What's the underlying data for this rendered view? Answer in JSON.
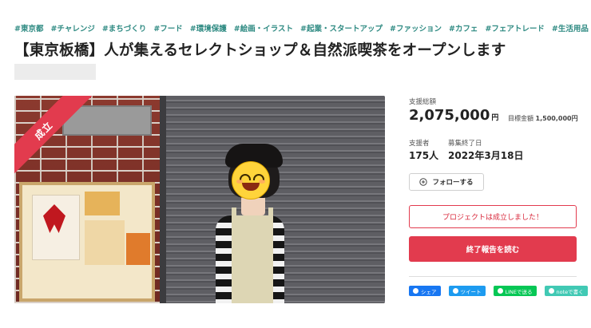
{
  "tags": [
    "#東京都",
    "#チャレンジ",
    "#まちづくり",
    "#フード",
    "#環境保護",
    "#絵画・イラスト",
    "#起業・スタートアップ",
    "#ファッション",
    "#カフェ",
    "#フェアトレード",
    "#生活用品"
  ],
  "project": {
    "title": "【東京板橋】人が集えるセレクトショップ＆自然派喫茶をオープンします",
    "status_badge": "成立"
  },
  "stats": {
    "total_label": "支援総額",
    "total_amount": "2,075,000",
    "currency": "円",
    "goal_label": "目標金額",
    "goal_amount": "1,500,000円",
    "supporters_label": "支援者",
    "supporters_value": "175人",
    "end_label": "募集終了日",
    "end_value": "2022年3月18日"
  },
  "buttons": {
    "follow": "フォローする",
    "success_notice": "プロジェクトは成立しました！",
    "report": "終了報告を読む"
  },
  "share": [
    {
      "label": "シェア",
      "color": "#1877f2",
      "icon": "facebook-icon"
    },
    {
      "label": "ツイート",
      "color": "#1d9bf0",
      "icon": "twitter-icon"
    },
    {
      "label": "LINEで送る",
      "color": "#06c755",
      "icon": "line-icon"
    },
    {
      "label": "noteで書く",
      "color": "#41c9b4",
      "icon": "note-icon"
    }
  ],
  "colors": {
    "accent": "#e23b4e",
    "tag": "#2e8a82"
  }
}
